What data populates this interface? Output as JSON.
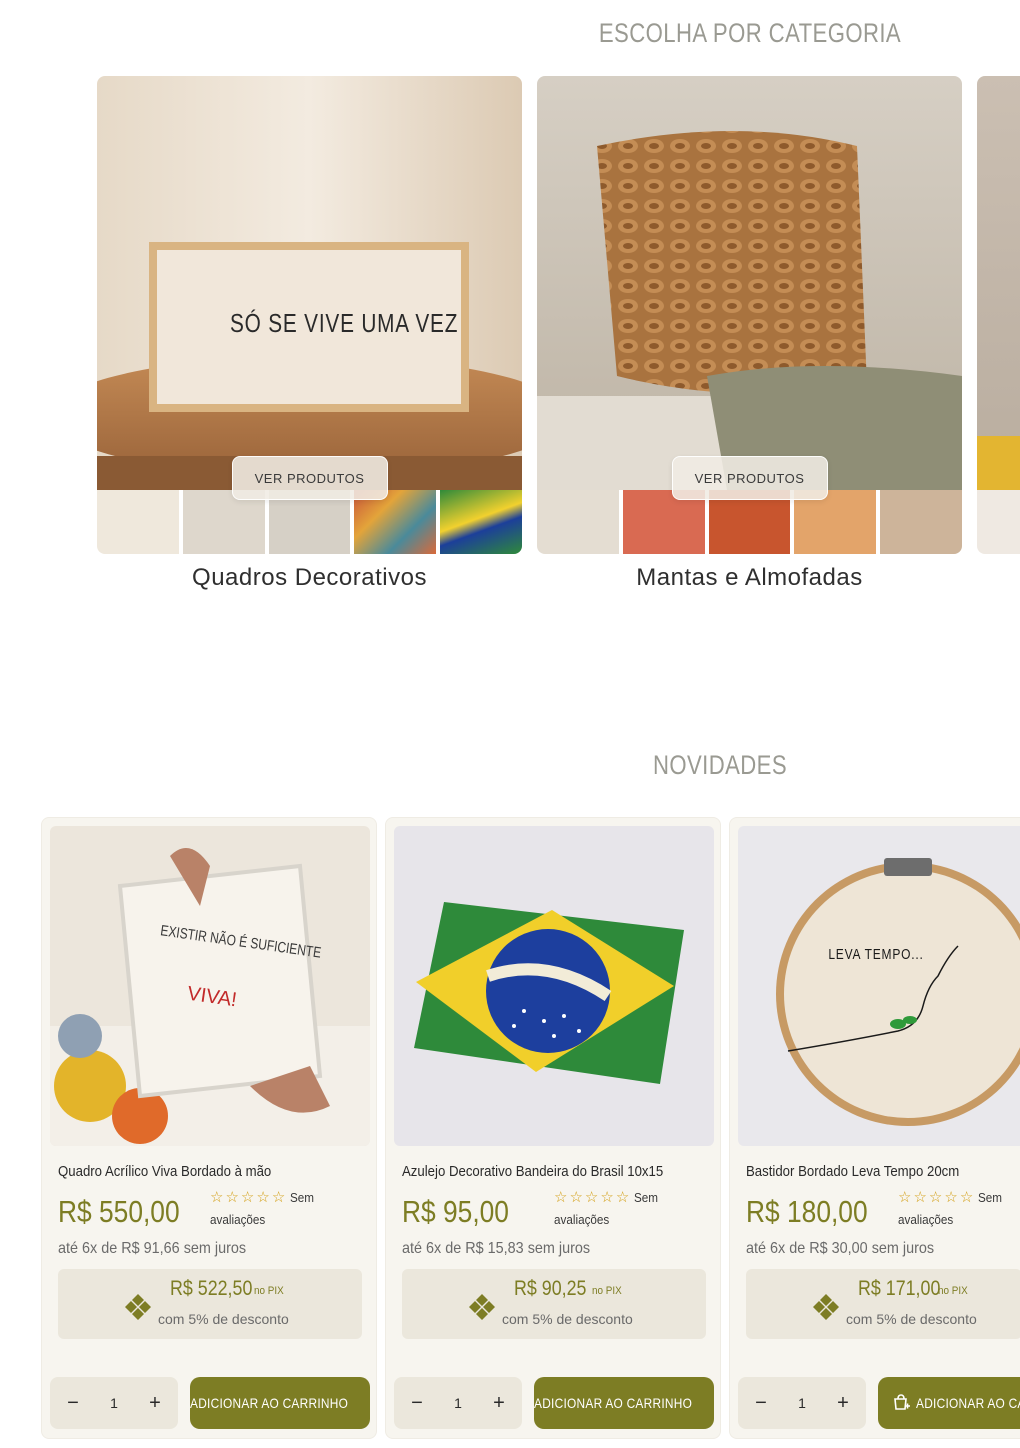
{
  "categories_section": {
    "title": "ESCOLHA POR CATEGORIA",
    "cards": [
      {
        "name": "Quadros Decorativos",
        "button": "VER PRODUTOS",
        "hero_text": "SÓ SE VIVE UMA VEZ"
      },
      {
        "name": "Mantas e Almofadas",
        "button": "VER PRODUTOS"
      }
    ]
  },
  "new_section": {
    "title": "NOVIDADES",
    "products": [
      {
        "name": "Quadro Acrílico Viva Bordado à mão",
        "price": "R$ 550,00",
        "rating_text": "Sem",
        "rating_text2": "avaliações",
        "installments": "até 6x de R$ 91,66 sem juros",
        "pix_price": "R$ 522,50",
        "pix_label": "no PIX",
        "pix_discount": "com 5% de desconto",
        "qty": "1",
        "add_label": "ADICIONAR AO CARRINHO",
        "img_text1": "EXISTIR NÃO É SUFICIENTE",
        "img_text2": "VIVA!"
      },
      {
        "name": "Azulejo Decorativo Bandeira do Brasil 10x15",
        "price": "R$ 95,00",
        "rating_text": "Sem",
        "rating_text2": "avaliações",
        "installments": "até 6x de R$ 15,83 sem juros",
        "pix_price": "R$ 90,25",
        "pix_label": "no PIX",
        "pix_discount": "com 5% de desconto",
        "qty": "1",
        "add_label": "ADICIONAR AO CARRINHO"
      },
      {
        "name": "Bastidor Bordado Leva Tempo 20cm",
        "price": "R$ 180,00",
        "rating_text": "Sem",
        "rating_text2": "avaliações",
        "installments": "até 6x de R$ 30,00 sem juros",
        "pix_price": "R$ 171,00",
        "pix_label": "no PIX",
        "pix_discount": "com 5% de desconto",
        "qty": "1",
        "add_label": "ADICIONAR AO CARRINHO",
        "img_text": "LEVA TEMPO..."
      }
    ]
  },
  "colors": {
    "accent": "#7d7d24",
    "title_gray": "#9a9a92",
    "card_bg": "#f7f5ef",
    "pix_bg": "#ebe7dc",
    "star": "#d4a017"
  },
  "icons": [
    "star-icon",
    "pix-icon",
    "minus-icon",
    "plus-icon",
    "cart-add-icon"
  ]
}
